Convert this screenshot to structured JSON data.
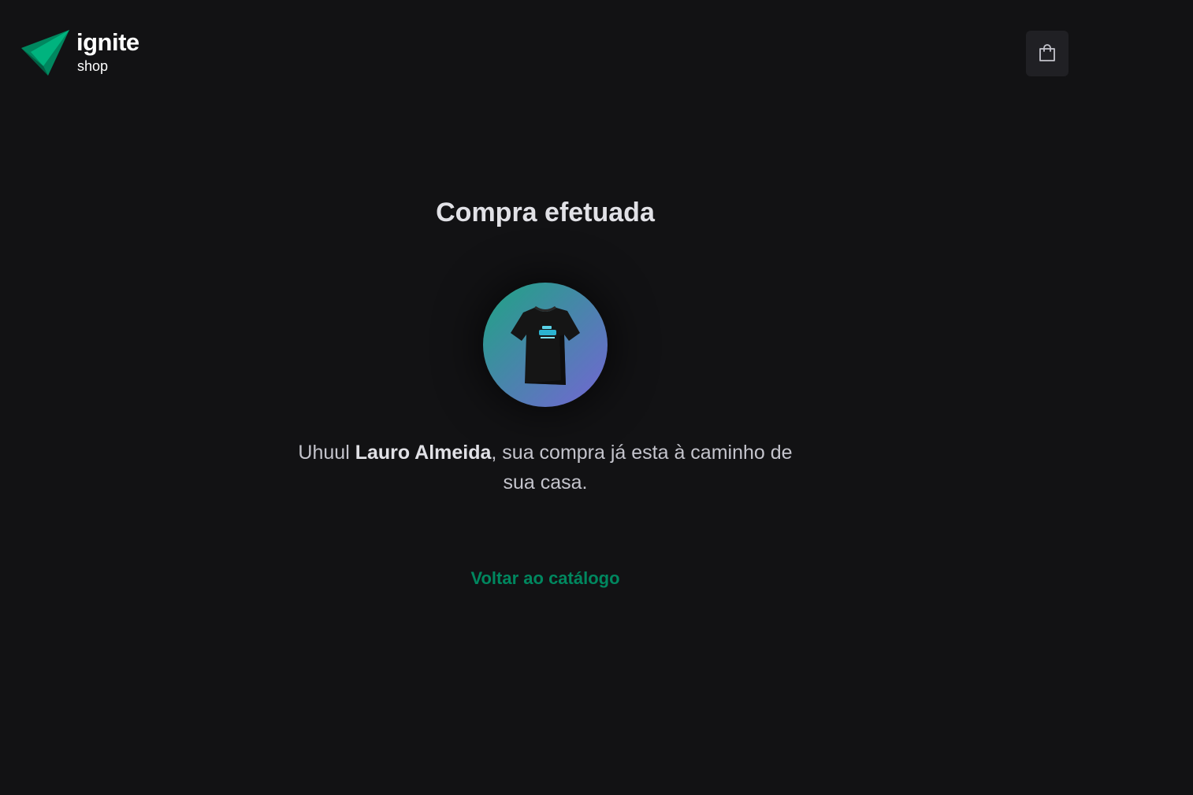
{
  "header": {
    "logo": {
      "title": "ignite",
      "subtitle": "shop",
      "icon": "ignite-logo-icon",
      "colors": [
        "#00875f",
        "#00b37e",
        "#015f43"
      ]
    },
    "cart": {
      "icon": "shopping-bag-icon"
    }
  },
  "success": {
    "title": "Compra efetuada",
    "product_image": {
      "icon": "t-shirt-icon",
      "gradient": [
        "#1ea483",
        "#7465d4"
      ]
    },
    "message_prefix": "Uhuul ",
    "customer_name": "Lauro Almeida",
    "message_suffix": ", sua compra já esta à caminho de sua casa.",
    "back_link_label": "Voltar ao catálogo"
  },
  "colors": {
    "background": "#121214",
    "surface": "#202024",
    "text": "#e1e1e6",
    "accent": "#00875f"
  }
}
